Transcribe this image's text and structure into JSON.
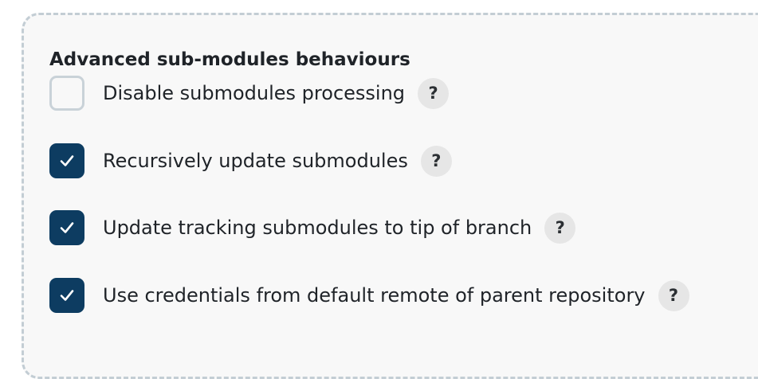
{
  "section": {
    "title": "Advanced sub-modules behaviours"
  },
  "options": [
    {
      "label": "Disable submodules processing",
      "checked": false,
      "help": "?"
    },
    {
      "label": "Recursively update submodules",
      "checked": true,
      "help": "?"
    },
    {
      "label": "Update tracking submodules to tip of branch",
      "checked": true,
      "help": "?"
    },
    {
      "label": "Use credentials from default remote of parent repository",
      "checked": true,
      "help": "?"
    }
  ],
  "colors": {
    "checkbox_checked": "#0d3c61",
    "checkbox_unchecked_border": "#c9d2d8",
    "help_background": "#e6e6e6",
    "panel_border": "#c3cdd4",
    "panel_background": "#f8f8f8"
  },
  "icons": {
    "checkmark": "check-icon",
    "help": "help-icon"
  }
}
